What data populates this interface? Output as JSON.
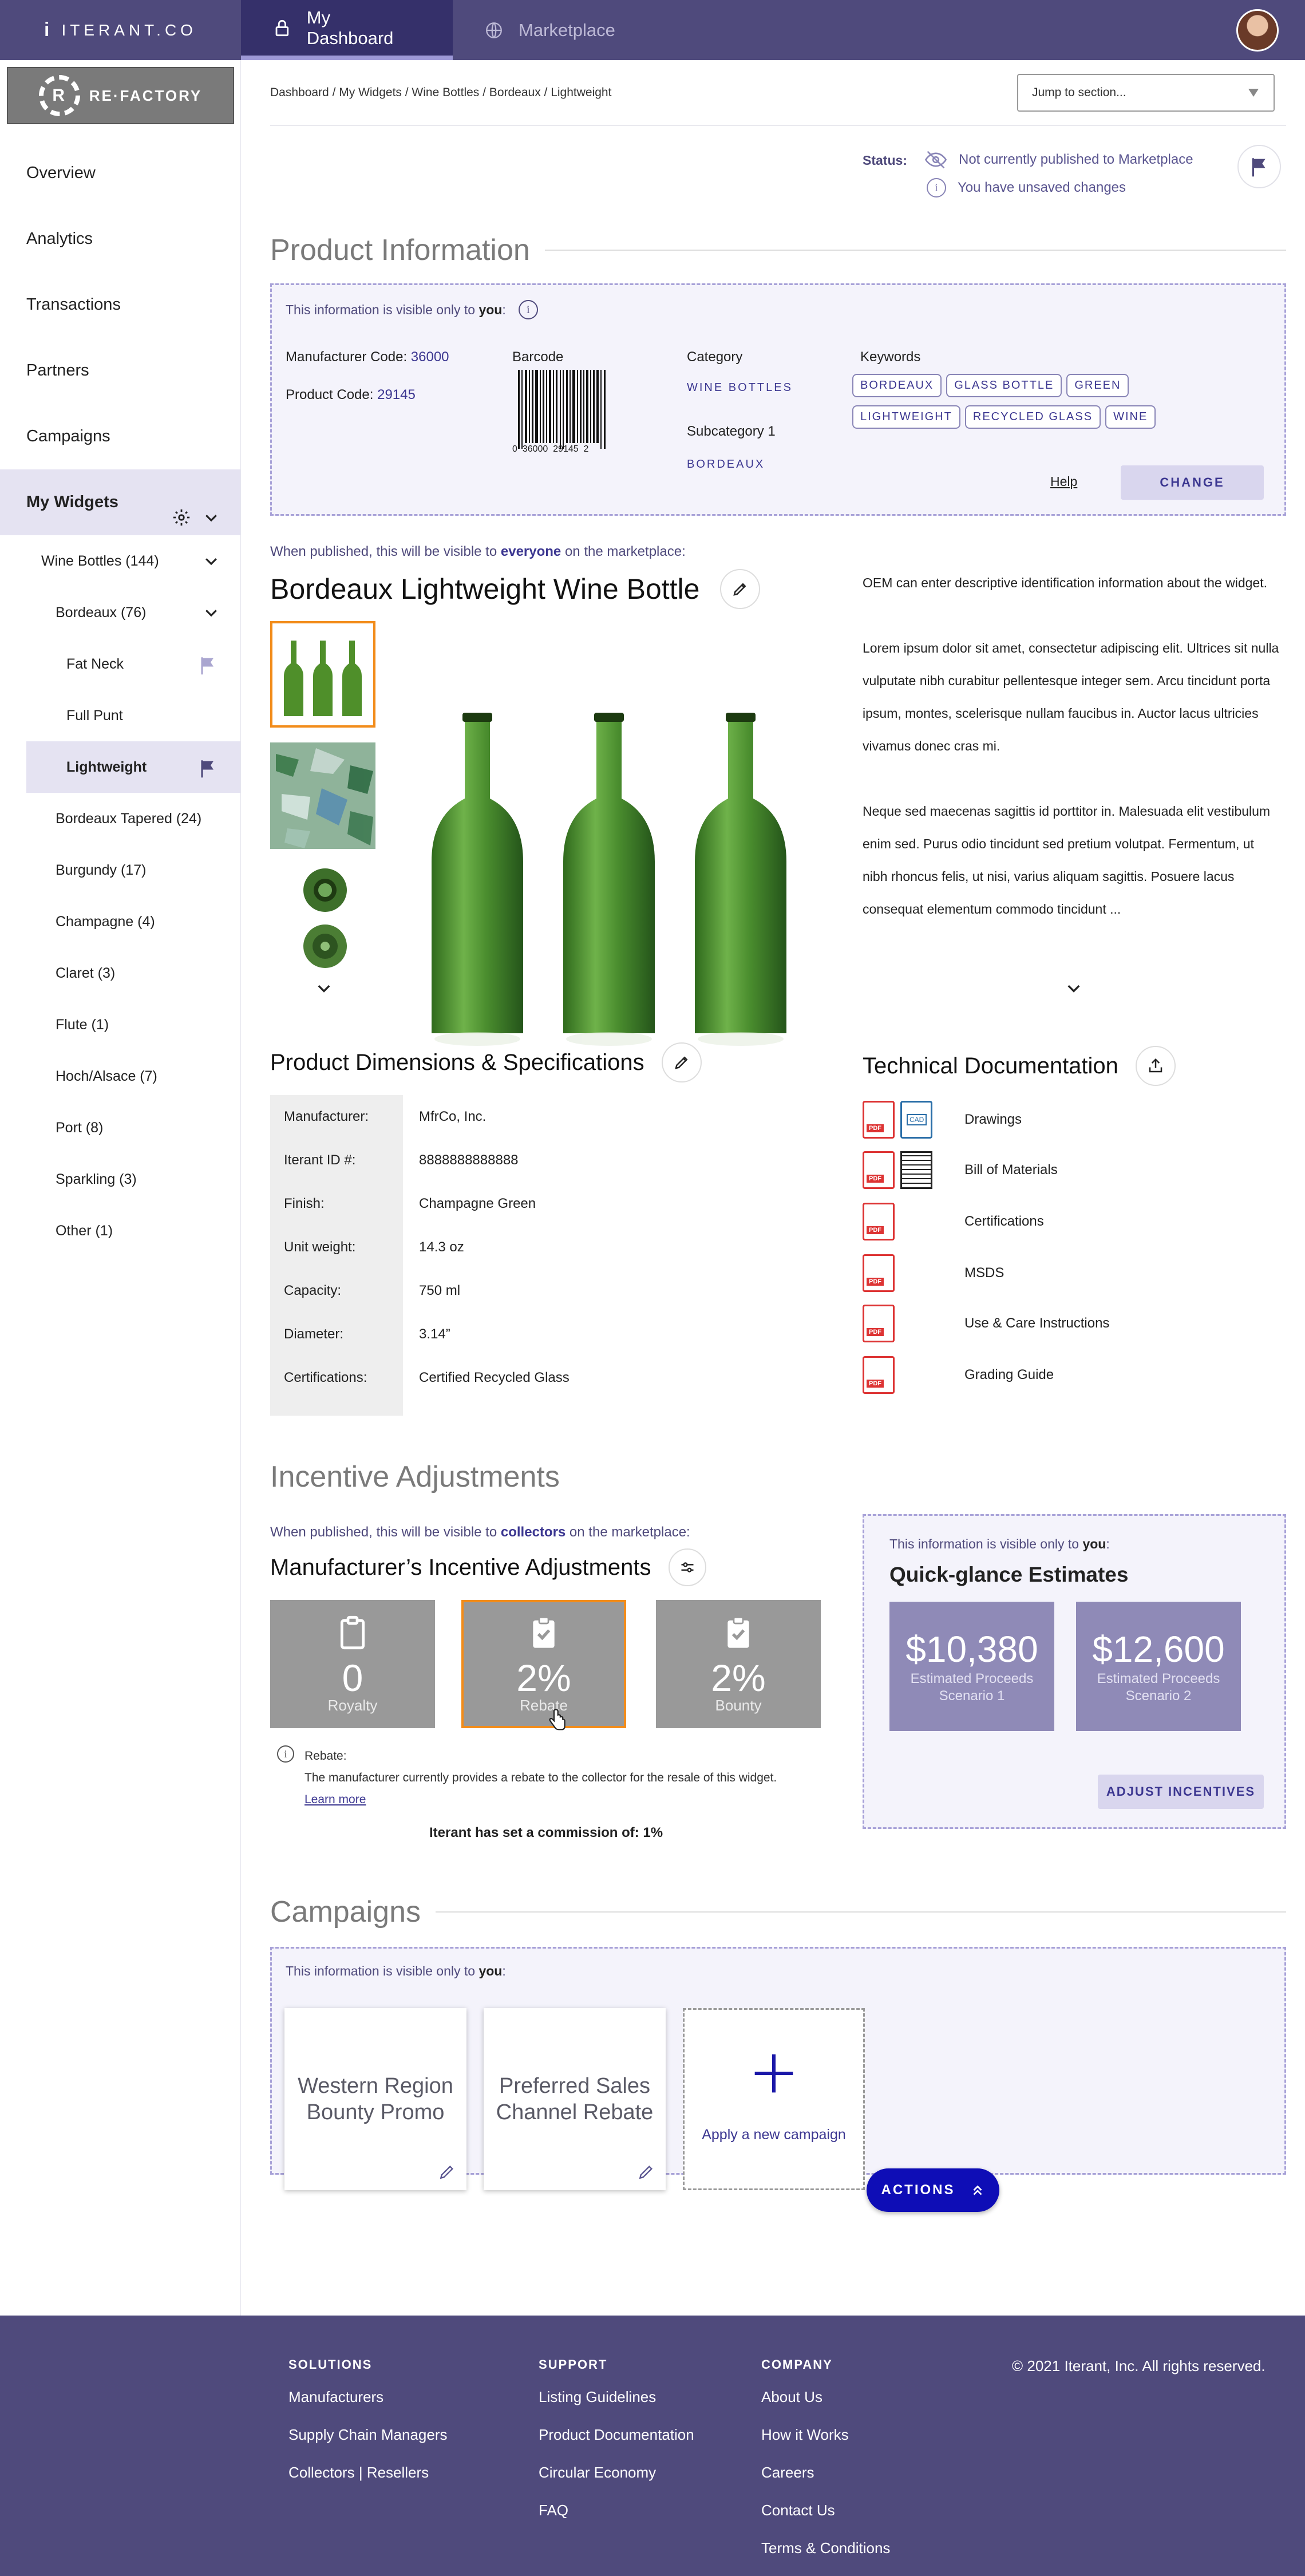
{
  "header": {
    "brand": "ITERANT.CO",
    "tabs": [
      {
        "label": "My Dashboard",
        "active": true
      },
      {
        "label": "Marketplace",
        "active": false
      }
    ]
  },
  "sidebar": {
    "logo_text": "RE·FACTORY",
    "logo_letter": "R",
    "nav": [
      "Overview",
      "Analytics",
      "Transactions",
      "Partners",
      "Campaigns"
    ],
    "group_label": "My Widgets",
    "tree": {
      "wine_bottles": "Wine Bottles (144)",
      "bordeaux": "Bordeaux (76)",
      "fat_neck": "Fat Neck",
      "full_punt": "Full Punt",
      "lightweight": "Lightweight",
      "others": [
        "Bordeaux Tapered (24)",
        "Burgundy (17)",
        "Champagne (4)",
        "Claret (3)",
        "Flute (1)",
        "Hoch/Alsace (7)",
        "Port (8)",
        "Sparkling (3)",
        "Other (1)"
      ]
    }
  },
  "breadcrumb": "Dashboard / My Widgets / Wine Bottles / Bordeaux / Lightweight",
  "jump_select": "Jump to section...",
  "status": {
    "label": "Status:",
    "line1": "Not currently published to Marketplace",
    "line2": "You have unsaved changes"
  },
  "product_info": {
    "title": "Product Information",
    "visibility_prefix": "This information is visible only to ",
    "visibility_who": "you",
    "visibility_suffix": ":",
    "manufacturer_code_label": "Manufacturer Code:",
    "manufacturer_code": "36000",
    "product_code_label": "Product Code:",
    "product_code": "29145",
    "barcode_label": "Barcode",
    "barcode_digits": "0  36000  29145  2",
    "category_label": "Category",
    "category": "WINE BOTTLES",
    "subcategory_label": "Subcategory 1",
    "subcategory": "BORDEAUX",
    "keywords_label": "Keywords",
    "keywords": [
      "BORDEAUX",
      "GLASS BOTTLE",
      "GREEN",
      "LIGHTWEIGHT",
      "RECYCLED GLASS",
      "WINE"
    ],
    "help": "Help",
    "change_button": "CHANGE"
  },
  "product": {
    "public_prefix": "When published, this will be visible to ",
    "public_who": "everyone",
    "public_suffix": " on the marketplace:",
    "name": "Bordeaux Lightweight Wine Bottle",
    "description": [
      "OEM can enter descriptive identification information about the widget.",
      "Lorem ipsum dolor sit amet, consectetur adipiscing elit. Ultrices sit nulla vulputate nibh curabitur pellentesque integer sem. Arcu tincidunt porta ipsum, montes, scelerisque nullam faucibus in. Auctor lacus ultricies vivamus donec cras mi.",
      "Neque sed maecenas sagittis id porttitor in. Malesuada elit vestibulum enim sed. Purus odio tincidunt sed pretium volutpat. Fermentum, ut nibh rhoncus felis, ut nisi, varius aliquam sagittis. Posuere lacus consequat elementum commodo tincidunt ..."
    ]
  },
  "specs": {
    "title": "Product Dimensions & Specifications",
    "rows": [
      {
        "k": "Manufacturer:",
        "v": "MfrCo, Inc."
      },
      {
        "k": "Iterant ID #:",
        "v": "8888888888888"
      },
      {
        "k": "Finish:",
        "v": "Champagne Green"
      },
      {
        "k": "Unit weight:",
        "v": "14.3 oz"
      },
      {
        "k": "Capacity:",
        "v": "750 ml"
      },
      {
        "k": "Diameter:",
        "v": "3.14”"
      },
      {
        "k": "Certifications:",
        "v": "Certified Recycled Glass"
      }
    ]
  },
  "docs": {
    "title": "Technical Documentation",
    "items": [
      "Drawings",
      "Bill of Materials",
      "Certifications",
      "MSDS",
      "Use & Care Instructions",
      "Grading Guide"
    ],
    "pdf_tag": "PDF",
    "cad_tag": "CAD"
  },
  "incentives": {
    "title": "Incentive Adjustments",
    "public_prefix": "When published, this will be visible to ",
    "public_who": "collectors",
    "public_suffix": " on the marketplace:",
    "subtitle": "Manufacturer’s Incentive Adjustments",
    "cards": [
      {
        "value": "0",
        "label": "Royalty",
        "selected": false
      },
      {
        "value": "2%",
        "label": "Rebate",
        "selected": true
      },
      {
        "value": "2%",
        "label": "Bounty",
        "selected": false
      }
    ],
    "rebate_title": "Rebate:",
    "rebate_text": "The manufacturer currently provides a rebate to the collector for the resale of this widget.",
    "learn_more": "Learn more",
    "commission": "Iterant has set a commission of: 1%",
    "est_visibility_prefix": "This information is visible only to ",
    "est_visibility_who": "you",
    "est_title": "Quick-glance Estimates",
    "estimates": [
      {
        "value": "$10,380",
        "label": "Estimated Proceeds Scenario 1"
      },
      {
        "value": "$12,600",
        "label": "Estimated Proceeds Scenario 2"
      }
    ],
    "adjust_button": "ADJUST INCENTIVES"
  },
  "campaigns": {
    "title": "Campaigns",
    "visibility_prefix": "This information is visible only to ",
    "visibility_who": "you",
    "items": [
      "Western Region Bounty Promo",
      "Preferred Sales Channel Rebate"
    ],
    "add_label": "Apply a new campaign"
  },
  "actions_button": "ACTIONS",
  "footer": {
    "columns": [
      {
        "title": "SOLUTIONS",
        "links": [
          "Manufacturers",
          "Supply Chain Managers",
          "Collectors | Resellers"
        ]
      },
      {
        "title": "SUPPORT",
        "links": [
          "Listing Guidelines",
          "Product Documentation",
          "Circular Economy",
          "FAQ"
        ]
      },
      {
        "title": "COMPANY",
        "links": [
          "About Us",
          "How it Works",
          "Careers",
          "Contact Us",
          "Terms & Conditions"
        ]
      }
    ],
    "copyright": "© 2021 Iterant, Inc. All rights reserved."
  },
  "colors": {
    "brand": "#4f4a7c",
    "accent": "#3c3791",
    "primary_button": "#0e0db6",
    "selection": "#f28c1a",
    "pdf_red": "#dd3333"
  }
}
